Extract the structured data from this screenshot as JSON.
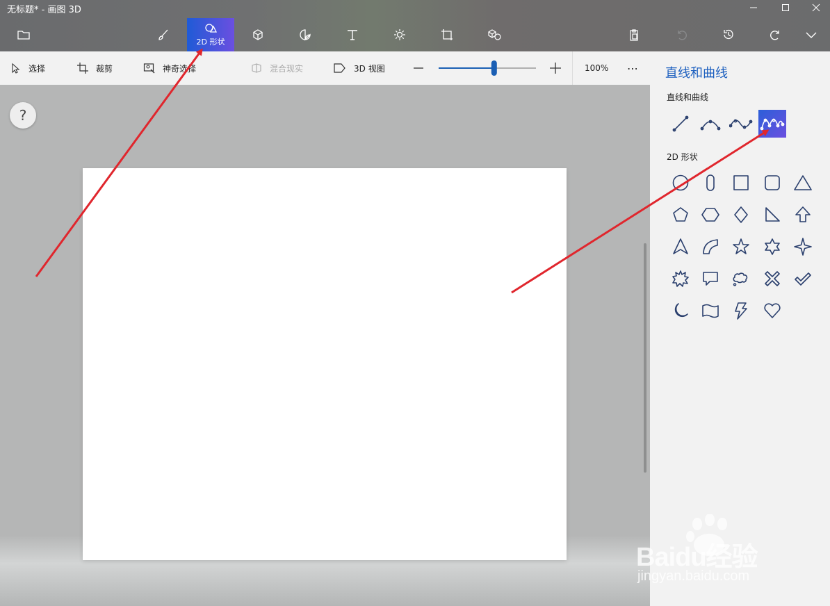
{
  "window": {
    "title": "无标题* - 画图 3D",
    "controls": [
      "minimize-icon",
      "maximize-icon",
      "close-icon"
    ]
  },
  "toolbar": {
    "active_tool_label": "2D 形状",
    "tools": [
      "brush-icon",
      "2d-shapes-icon",
      "cube-icon",
      "sticker-icon",
      "text-icon",
      "effects-icon",
      "canvas-icon",
      "3d-library-icon"
    ],
    "right_tools": [
      "paste-icon",
      "undo-icon",
      "history-icon",
      "redo-icon",
      "expand-icon"
    ]
  },
  "commands": {
    "select": "选择",
    "crop": "裁剪",
    "magic_select": "神奇选择",
    "mixed_reality": "混合现实",
    "view_3d": "3D 视图",
    "zoom_value": "100%",
    "zoom_fraction": 0.57,
    "more": "⋯"
  },
  "help": {
    "label": "?"
  },
  "panel": {
    "title": "直线和曲线",
    "section_lines": "直线和曲线",
    "section_shapes": "2D 形状",
    "line_tools": [
      "line-icon",
      "curve-icon",
      "two-point-curve-icon",
      "three-point-curve-icon"
    ],
    "selected_line_tool": "three-point-curve-icon",
    "shapes": [
      "circle",
      "capsule",
      "square",
      "rounded-square",
      "triangle",
      "pentagon",
      "hexagon",
      "diamond",
      "right-triangle",
      "arrow-up",
      "arrow-head",
      "quarter-pie",
      "star-5",
      "star-6",
      "star-4",
      "burst",
      "speech-bubble",
      "thought-bubble",
      "cross",
      "checkmark",
      "moon",
      "banner",
      "lightning",
      "heart"
    ]
  },
  "watermark": {
    "brand": "Baidu经验",
    "url": "jingyan.baidu.com"
  },
  "colors": {
    "accent": "#1f5bd6",
    "accent2": "#6b4fe0",
    "panel_title": "#1c5fbf",
    "arrow": "#e0262d"
  }
}
